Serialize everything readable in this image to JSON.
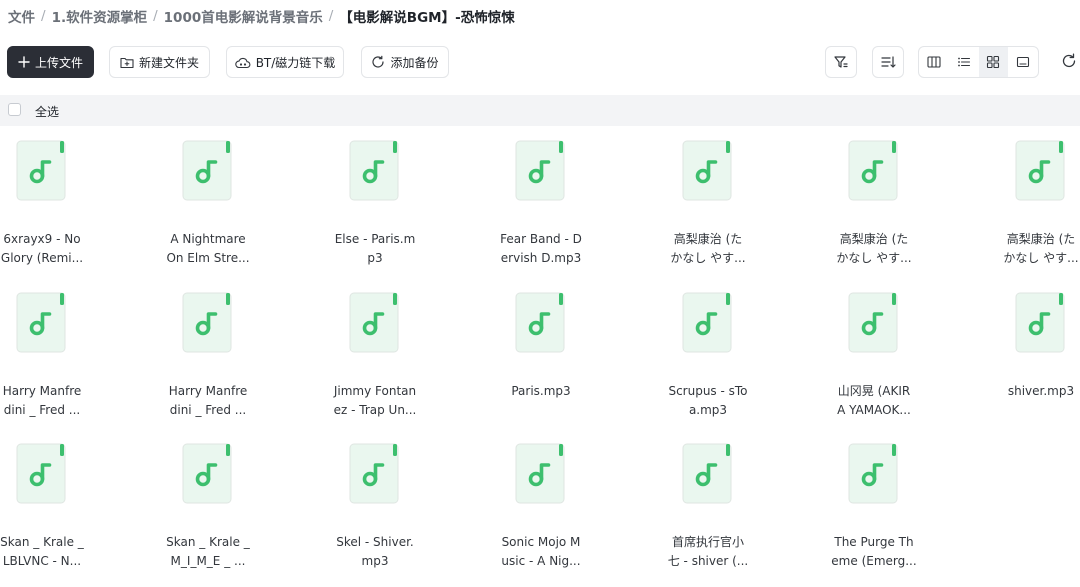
{
  "breadcrumb": [
    {
      "label": "文件"
    },
    {
      "label": "1.软件资源掌柜"
    },
    {
      "label": "1000首电影解说背景音乐"
    },
    {
      "label": "【电影解说BGM】-恐怖惊悚"
    }
  ],
  "toolbar": {
    "upload_label": "上传文件",
    "new_folder_label": "新建文件夹",
    "bt_label": "BT/磁力链下载",
    "backup_label": "添加备份"
  },
  "select_all_label": "全选",
  "files": [
    {
      "line1": "6xrayx9 - No",
      "line2": "Glory (Remi..."
    },
    {
      "line1": "A Nightmare",
      "line2": "On Elm Stre..."
    },
    {
      "line1": "Else - Paris.m",
      "line2": "p3"
    },
    {
      "line1": "Fear Band - D",
      "line2": "ervish D.mp3"
    },
    {
      "line1": "高梨康治 (た",
      "line2": "かなし やす..."
    },
    {
      "line1": "高梨康治 (た",
      "line2": "かなし やす..."
    },
    {
      "line1": "高梨康治 (た",
      "line2": "かなし やす..."
    },
    {
      "line1": "Harry Manfre",
      "line2": "dini _ Fred ..."
    },
    {
      "line1": "Harry Manfre",
      "line2": "dini _ Fred ..."
    },
    {
      "line1": "Jimmy Fontan",
      "line2": "ez - Trap Un..."
    },
    {
      "line1": "Paris.mp3",
      "line2": ""
    },
    {
      "line1": "Scrupus - sTo",
      "line2": "a.mp3"
    },
    {
      "line1": "山冈晃 (AKIR",
      "line2": "A YAMAOK..."
    },
    {
      "line1": "shiver.mp3",
      "line2": ""
    },
    {
      "line1": "Skan _ Krale _",
      "line2": "LBLVNC - N..."
    },
    {
      "line1": "Skan _ Krale _",
      "line2": "M_I_M_E _ ..."
    },
    {
      "line1": "Skel - Shiver.",
      "line2": "mp3"
    },
    {
      "line1": "Sonic Mojo M",
      "line2": "usic - A Nig..."
    },
    {
      "line1": "首席执行官小",
      "line2": "七 - shiver (..."
    },
    {
      "line1": "The Purge Th",
      "line2": "eme (Emerg..."
    }
  ],
  "icons": {
    "file": "music-file-icon",
    "accent": "#3dbf6e",
    "file_bg": "#eaf7ef"
  }
}
